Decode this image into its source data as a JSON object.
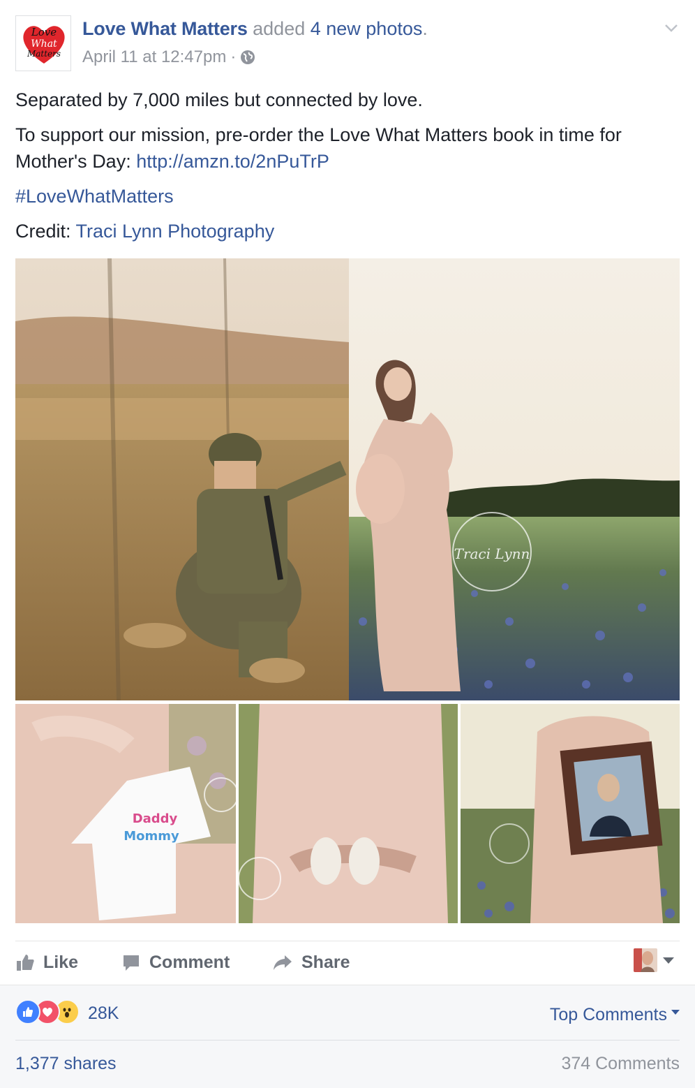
{
  "header": {
    "page_name": "Love What Matters",
    "added_text": " added ",
    "new_photos": "4 new photos",
    "period": ".",
    "timestamp": "April 11 at 12:47pm",
    "separator": "·",
    "logo_icon": "love-what-matters-logo-icon",
    "privacy_icon": "globe-icon",
    "options_icon": "chevron-down-icon"
  },
  "body": {
    "line1": "Separated by 7,000 miles but connected by love.",
    "line2_text": "To support our mission, pre-order the Love What Matters book in time for Mother's Day: ",
    "line2_link": "http://amzn.to/2nPuTrP",
    "hashtag": "#LoveWhatMatters",
    "credit_label": "Credit: ",
    "credit_link": "Traci Lynn Photography"
  },
  "photos": {
    "main_left": "soldier-kneeling-photo",
    "main_right": "pregnant-woman-field-photo",
    "thumb1": "onesie-photo",
    "thumb2": "baby-shoes-photo",
    "thumb3": "framed-portrait-photo",
    "watermark_text": "Traci Lynn"
  },
  "actions": {
    "like": "Like",
    "comment": "Comment",
    "share": "Share"
  },
  "reactions": {
    "count": "28K",
    "types": [
      "like",
      "love",
      "wow"
    ],
    "top_comments": "Top Comments"
  },
  "stats": {
    "shares": "1,377 shares",
    "comments": "374 Comments"
  },
  "colors": {
    "link": "#365899",
    "muted": "#90949c",
    "text": "#1d2129",
    "like_blue": "#4080ff",
    "love_red": "#f25268",
    "wow_yellow": "#fbcd4b"
  }
}
